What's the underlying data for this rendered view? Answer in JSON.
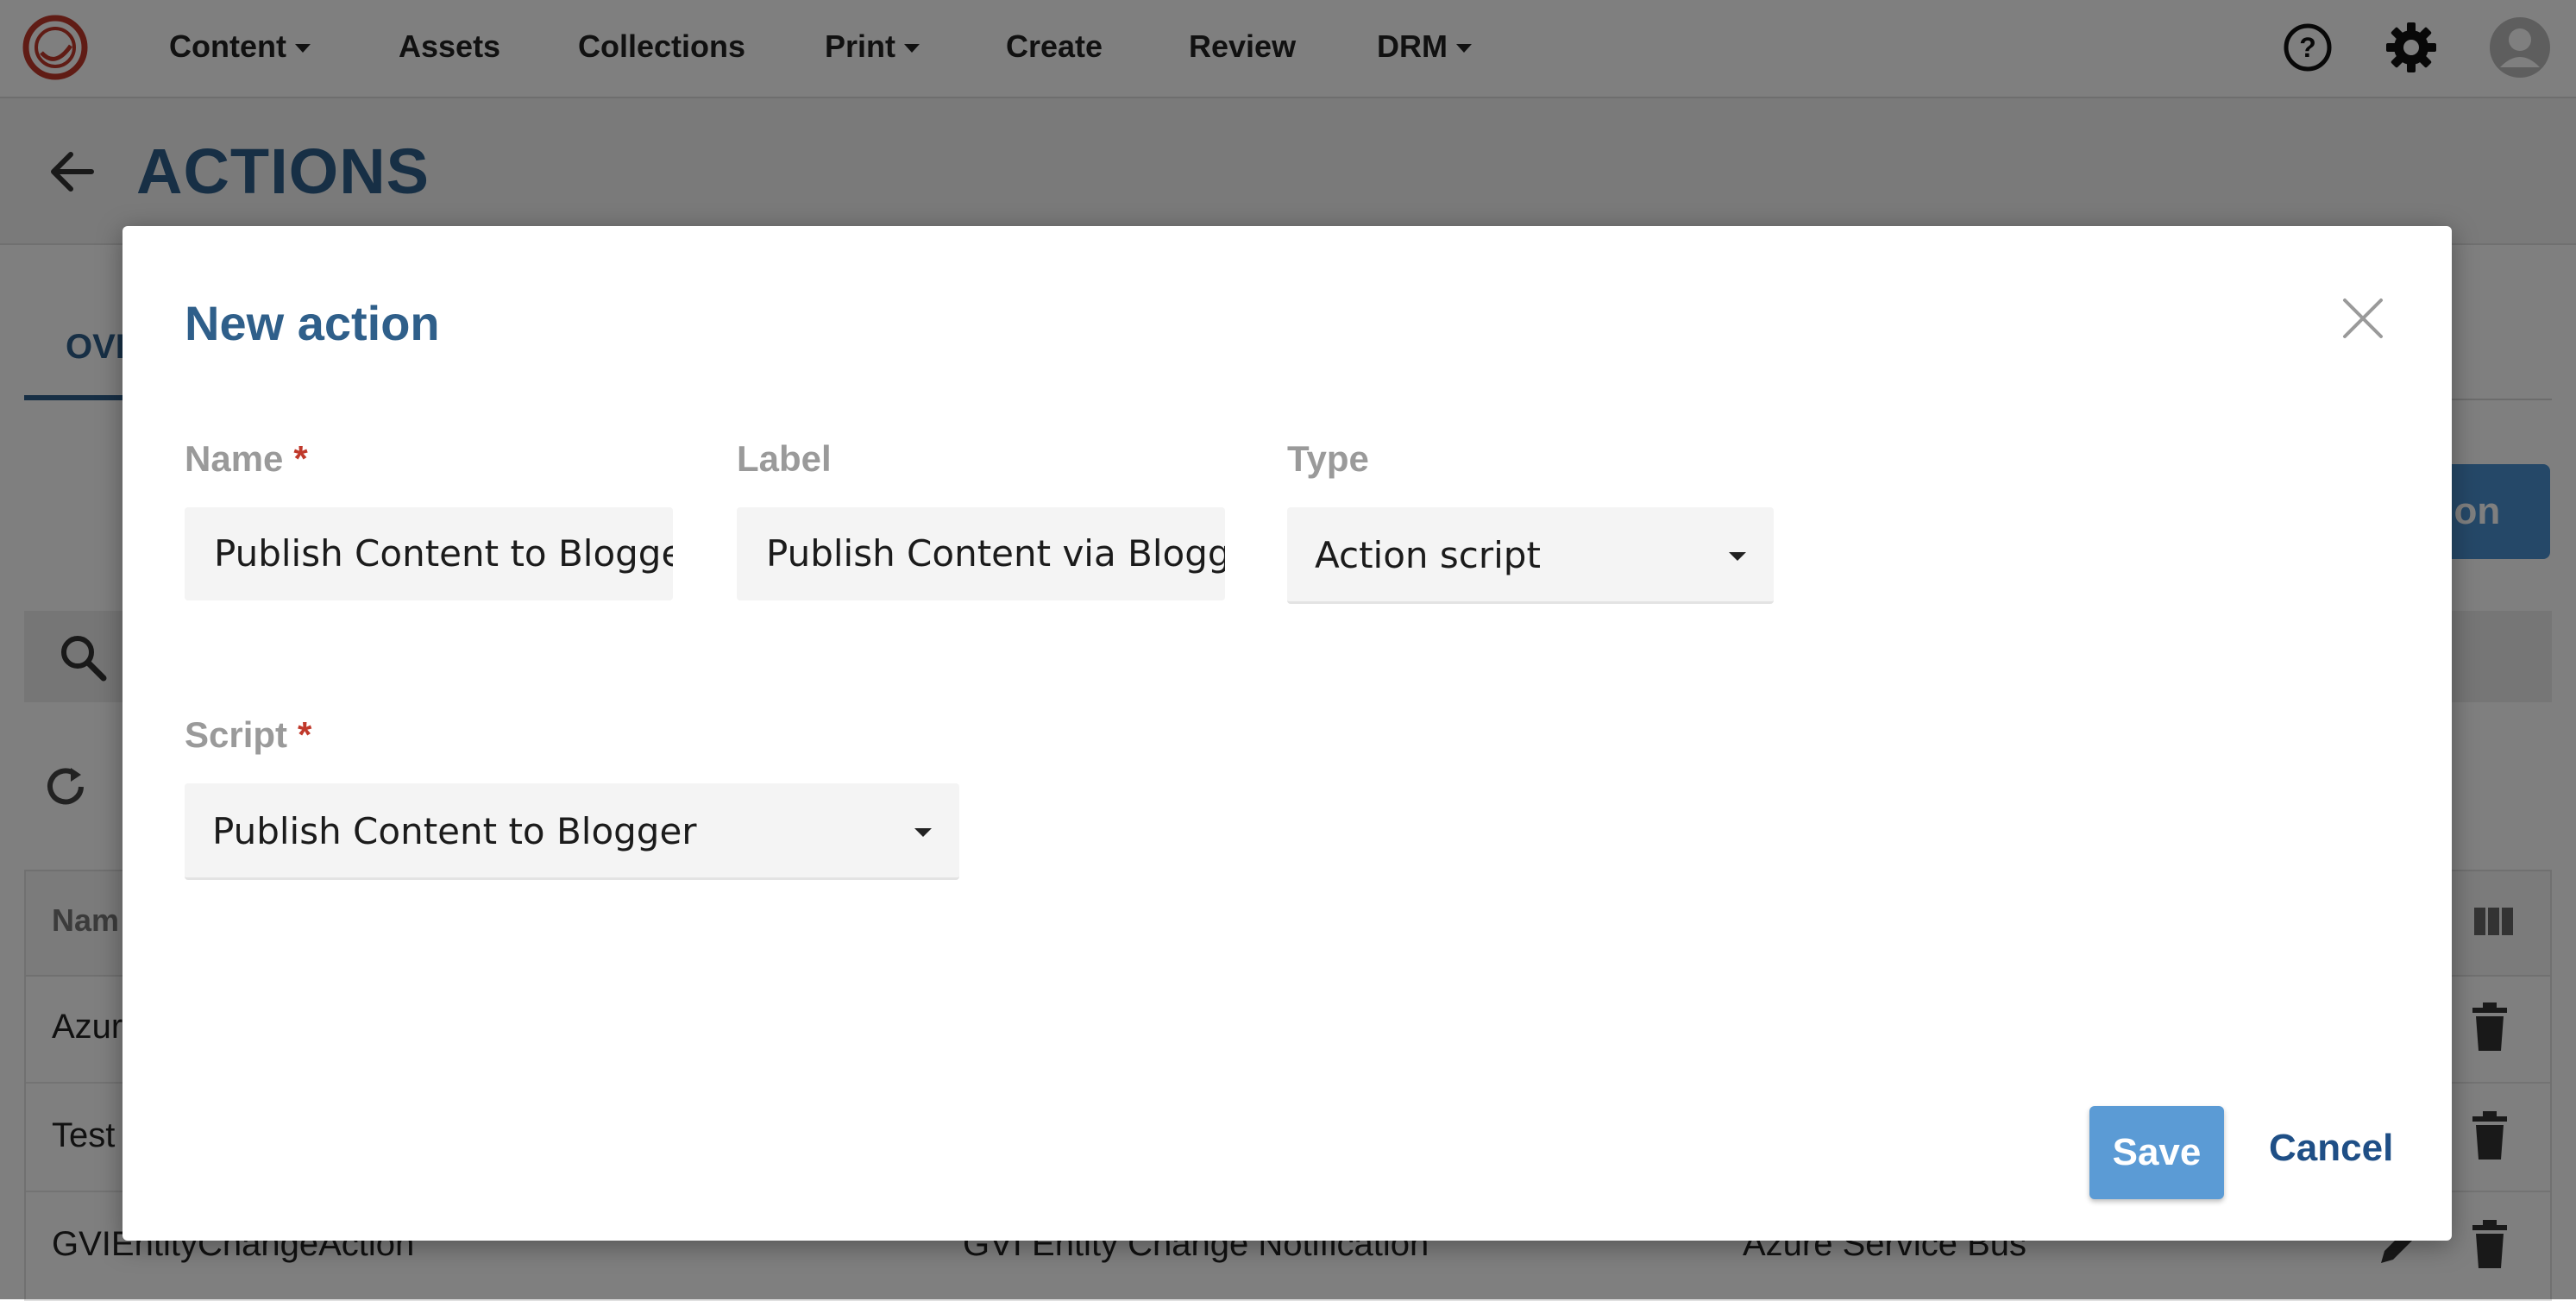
{
  "nav": {
    "items": [
      {
        "label": "Content",
        "dropdown": true
      },
      {
        "label": "Assets",
        "dropdown": false
      },
      {
        "label": "Collections",
        "dropdown": false
      },
      {
        "label": "Print",
        "dropdown": true
      },
      {
        "label": "Create",
        "dropdown": false
      },
      {
        "label": "Review",
        "dropdown": false
      },
      {
        "label": "DRM",
        "dropdown": true
      }
    ],
    "icons": [
      "help-icon",
      "gear-icon",
      "user-avatar-icon"
    ]
  },
  "page": {
    "title": "ACTIONS",
    "tab_label": "OVI",
    "add_button_label": "tion"
  },
  "table": {
    "header_name": "Nam",
    "rows": [
      {
        "name": "Azur",
        "label": "",
        "type": ""
      },
      {
        "name": "Test",
        "label": "",
        "type": ""
      },
      {
        "name": "GVIEntityChangeAction",
        "label": "GVI Entity Change Notification",
        "type": "Azure Service Bus"
      }
    ]
  },
  "modal": {
    "title": "New action",
    "name": {
      "label": "Name",
      "required_mark": "*",
      "value": "Publish Content to Blogger"
    },
    "label": {
      "label": "Label",
      "value": "Publish Content via Blogger"
    },
    "type": {
      "label": "Type",
      "value": "Action script"
    },
    "script": {
      "label": "Script",
      "required_mark": "*",
      "value": "Publish Content to Blogger"
    },
    "save_label": "Save",
    "cancel_label": "Cancel"
  },
  "colors": {
    "brand_blue": "#2f5f8a",
    "primary_button": "#5b9bd5",
    "required": "#c0392b",
    "logo_red": "#c0392b"
  }
}
